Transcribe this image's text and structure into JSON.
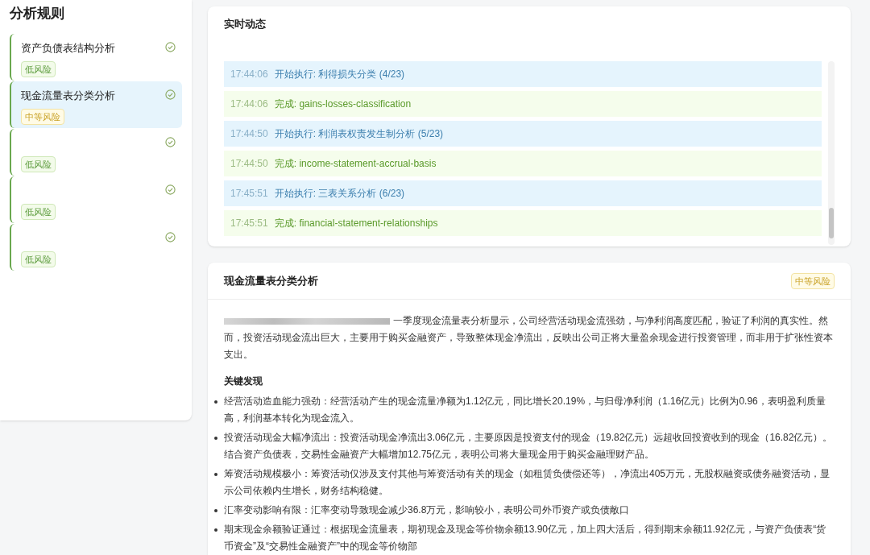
{
  "sidebar": {
    "title": "分析规则",
    "items": [
      {
        "title": "资产负债表结构分析",
        "risk": {
          "label": "低风险",
          "kind": "low"
        },
        "done": true,
        "selected": false
      },
      {
        "title": "现金流量表分类分析",
        "risk": {
          "label": "中等风险",
          "kind": "medium"
        },
        "done": true,
        "selected": true
      },
      {
        "risk": {
          "label": "低风险",
          "kind": "low"
        },
        "done": true,
        "selected": false
      },
      {
        "risk": {
          "label": "低风险",
          "kind": "low"
        },
        "done": true,
        "selected": false
      },
      {
        "risk": {
          "label": "低风险",
          "kind": "low"
        },
        "done": true,
        "selected": false
      }
    ]
  },
  "live": {
    "title": "实时动态",
    "entries": [
      {
        "kind": "start",
        "time": "17:44:06",
        "text": "开始执行: 利得损失分类 (4/23)"
      },
      {
        "kind": "done",
        "time": "17:44:06",
        "text": "完成: gains-losses-classification"
      },
      {
        "kind": "start",
        "time": "17:44:50",
        "text": "开始执行: 利润表权责发生制分析 (5/23)"
      },
      {
        "kind": "done",
        "time": "17:44:50",
        "text": "完成: income-statement-accrual-basis"
      },
      {
        "kind": "start",
        "time": "17:45:51",
        "text": "开始执行: 三表关系分析 (6/23)"
      },
      {
        "kind": "done",
        "time": "17:45:51",
        "text": "完成: financial-statement-relationships"
      }
    ]
  },
  "detail": {
    "title": "现金流量表分类分析",
    "risk": {
      "label": "中等风险",
      "kind": "medium"
    },
    "summary": "一季度现金流量表分析显示，公司经营活动现金流强劲，与净利润高度匹配，验证了利润的真实性。然而，投资活动现金流出巨大，主要用于购买金融资产，导致整体现金净流出，反映出公司正将大量盈余现金进行投资管理，而非用于扩张性资本支出。",
    "findings_title": "关键发现",
    "findings": [
      "经营活动造血能力强劲：经营活动产生的现金流量净额为1.12亿元，同比增长20.19%，与归母净利润（1.16亿元）比例为0.96，表明盈利质量高，利润基本转化为现金流入。",
      "投资活动现金大幅净流出：投资活动现金净流出3.06亿元，主要原因是投资支付的现金（19.82亿元）远超收回投资收到的现金（16.82亿元）。结合资产负债表，交易性金融资产大幅增加12.75亿元，表明公司将大量现金用于购买金融理财产品。",
      "筹资活动规模极小：筹资活动仅涉及支付其他与筹资活动有关的现金（如租赁负债偿还等），净流出405万元，无股权融资或债务融资活动，显示公司依赖内生增长，财务结构稳健。",
      "汇率变动影响有限：汇率变动导致现金减少36.8万元，影响较小，表明公司外币资产或负债敞口",
      "期末现金余额验证通过：根据现金流量表，期初现金及现金等价物余额13.90亿元，加上四大活后，得到期末余额11.92亿元，与资产负债表“货币资金”及“交易性金融资产”中的现金等价物部"
    ]
  }
}
